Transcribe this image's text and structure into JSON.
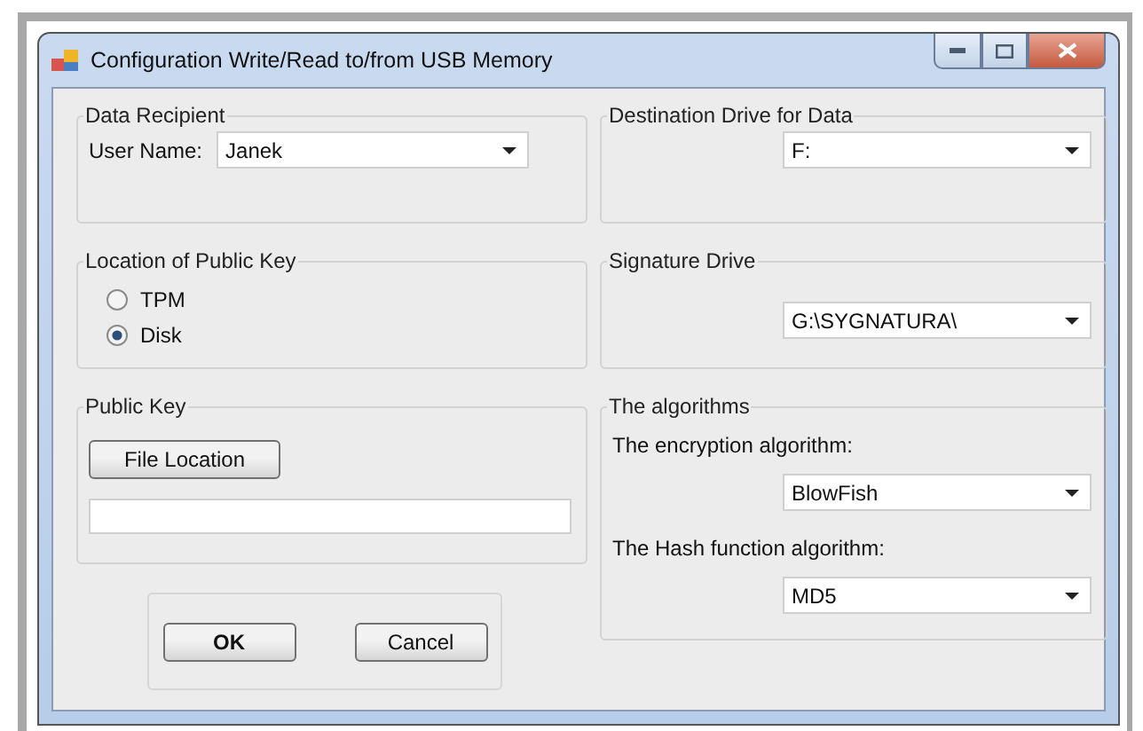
{
  "window": {
    "title": "Configuration Write/Read to/from USB Memory"
  },
  "data_recipient": {
    "title": "Data Recipient",
    "label": "User Name:",
    "value": "Janek"
  },
  "public_key_location": {
    "title": "Location of Public Key",
    "options": [
      {
        "label": "TPM",
        "selected": false
      },
      {
        "label": "Disk",
        "selected": true
      }
    ]
  },
  "public_key": {
    "title": "Public Key",
    "button": "File Location"
  },
  "destination_drive": {
    "title": "Destination Drive for Data",
    "value": "F:"
  },
  "signature_drive": {
    "title": "Signature Drive",
    "value": "G:\\SYGNATURA\\"
  },
  "algorithms": {
    "title": "The algorithms",
    "fields": [
      {
        "label": "The encryption algorithm:",
        "value": "BlowFish"
      },
      {
        "label": "The Hash function algorithm:",
        "value": "MD5"
      }
    ]
  },
  "buttons": [
    "OK",
    "Cancel"
  ]
}
